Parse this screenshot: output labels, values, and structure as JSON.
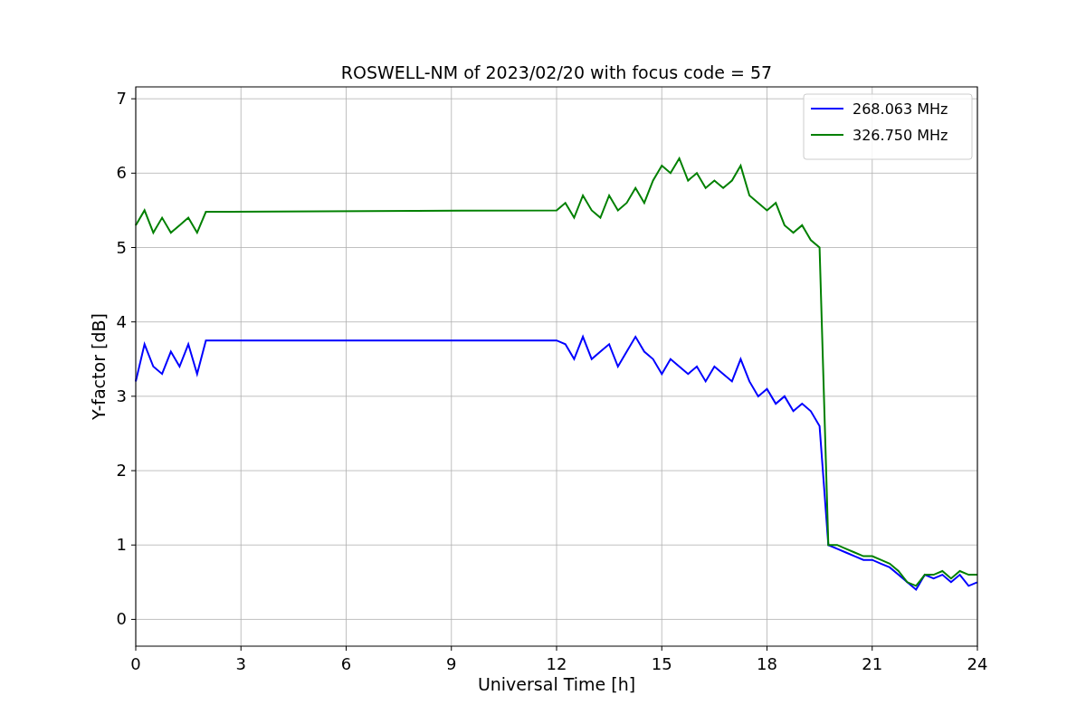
{
  "chart_data": {
    "type": "line",
    "title": "ROSWELL-NM of 2023/02/20 with focus code = 57",
    "xlabel": "Universal Time [h]",
    "ylabel": "Y-factor [dB]",
    "xlim": [
      0,
      24
    ],
    "ylim": [
      -0.36,
      7.16
    ],
    "grid": true,
    "legend": true,
    "xticks": [
      0,
      3,
      6,
      9,
      12,
      15,
      18,
      21,
      24
    ],
    "yticks": [
      0,
      1,
      2,
      3,
      4,
      5,
      6,
      7
    ],
    "x": [
      0,
      0.25,
      0.5,
      0.75,
      1,
      1.25,
      1.5,
      1.75,
      2,
      12,
      12.25,
      12.5,
      12.75,
      13,
      13.25,
      13.5,
      13.75,
      14,
      14.25,
      14.5,
      14.75,
      15,
      15.25,
      15.5,
      15.75,
      16,
      16.25,
      16.5,
      16.75,
      17,
      17.25,
      17.5,
      17.75,
      18,
      18.25,
      18.5,
      18.75,
      19,
      19.25,
      19.5,
      19.75,
      20,
      20.25,
      20.5,
      20.75,
      21,
      21.25,
      21.5,
      21.75,
      22,
      22.25,
      22.5,
      22.75,
      23,
      23.25,
      23.5,
      23.75,
      24
    ],
    "series": [
      {
        "name": "268.063 MHz",
        "color": "#0000ff",
        "values": [
          3.2,
          3.7,
          3.4,
          3.3,
          3.6,
          3.4,
          3.7,
          3.3,
          3.75,
          3.75,
          3.7,
          3.5,
          3.8,
          3.5,
          3.6,
          3.7,
          3.4,
          3.6,
          3.8,
          3.6,
          3.5,
          3.3,
          3.5,
          3.4,
          3.3,
          3.4,
          3.2,
          3.4,
          3.3,
          3.2,
          3.5,
          3.2,
          3.0,
          3.1,
          2.9,
          3.0,
          2.8,
          2.9,
          2.8,
          2.6,
          1.0,
          0.95,
          0.9,
          0.85,
          0.8,
          0.8,
          0.75,
          0.7,
          0.6,
          0.5,
          0.4,
          0.6,
          0.55,
          0.6,
          0.5,
          0.6,
          0.45,
          0.5
        ]
      },
      {
        "name": "326.750 MHz",
        "color": "#008000",
        "values": [
          5.3,
          5.5,
          5.2,
          5.4,
          5.2,
          5.3,
          5.4,
          5.2,
          5.48,
          5.5,
          5.6,
          5.4,
          5.7,
          5.5,
          5.4,
          5.7,
          5.5,
          5.6,
          5.8,
          5.6,
          5.9,
          6.1,
          6.0,
          6.2,
          5.9,
          6.0,
          5.8,
          5.9,
          5.8,
          5.9,
          6.1,
          5.7,
          5.6,
          5.5,
          5.6,
          5.3,
          5.2,
          5.3,
          5.1,
          5.0,
          1.0,
          1.0,
          0.95,
          0.9,
          0.85,
          0.85,
          0.8,
          0.75,
          0.65,
          0.5,
          0.45,
          0.6,
          0.6,
          0.65,
          0.55,
          0.65,
          0.6,
          0.6
        ]
      }
    ]
  }
}
